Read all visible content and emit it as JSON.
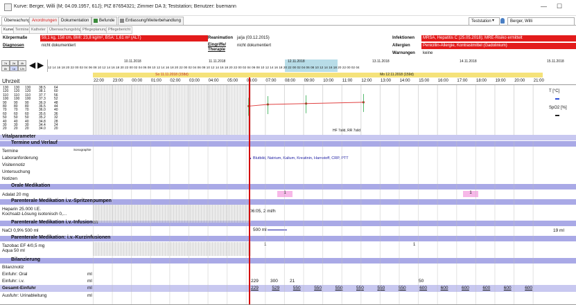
{
  "window": {
    "title": "Kurve: Berger, Willi (M; 04.09.1957, 61J); PIZ 87654321; Zimmer DA 3; Teststation; Benutzer: buemann",
    "station_select": "Teststation",
    "patient_select": "Berger, Willi"
  },
  "main_tabs": [
    "Überwachung",
    "Anordnungen",
    "Dokumentation",
    "Befunde",
    "Entlassung/Weiterbehandlung"
  ],
  "sub_tabs": [
    "Kurve",
    "Termine",
    "Katheter",
    "Überwachungsbögen",
    "Pflegeplanung",
    "Pflegebericht"
  ],
  "patient_info": {
    "koerpermasse_label": "Körpermaße",
    "koerpermasse_value": "59,1 kg, 158 cm, BMI: 23,8 kg/m², BSA: 1,61 m² (ALT)",
    "diagnosen_label": "Diagnosen",
    "diagnosen_value": "nicht dokumentiert",
    "reanimation_label": "Reanimation",
    "reanimation_value": "ja/ja (03.12.2015)",
    "eingriffe_label": "Eingriffe/ Therapie",
    "eingriffe_value": "nicht dokumentiert",
    "infektionen_label": "Infektionen",
    "infektionen_value": "MRSA, Hepatitis C (25.05.2018); MRE-Risiko ermittelt",
    "allergien_label": "Allergien",
    "allergien_value": "Penicillin-Allergie, Kontrastmittel (Gadolinium)",
    "warnungen_label": "Warnungen",
    "warnungen_value": "keine"
  },
  "timeline": {
    "zoom_buttons": [
      "7d",
      "2d",
      "4h",
      "8h",
      "1d",
      "12h"
    ],
    "dates": [
      "10.11.2018",
      "11.11.2018",
      "12.11.2018",
      "13.11.2018",
      "14.11.2018",
      "15.11.2018"
    ],
    "hour_ticks": "12 14 16 18 20 22 00 02 04 06 08 10 12 14 16 18 20 22 00 02 04 06 08 10 12 14 16 18 20 22 00 02 04 06 08 10 12 14 16 18 20 22 00 02 04 06 08 10 12 14 16 18 20 22 00 02 04 06 08 10 12 14 16 18 20 22 00 02 04",
    "day_left": "So 11.11.2018 (158d)",
    "day_right": "Mo 12.11.2018 (159d)",
    "uhrzeit_label": "Uhrzeit",
    "hours": [
      "22:00",
      "23:00",
      "00:00",
      "01:00",
      "02:00",
      "03:00",
      "04:00",
      "05:00",
      "06:00",
      "07:00",
      "08:00",
      "09:00",
      "10:00",
      "11:00",
      "12:00",
      "13:00",
      "14:00",
      "15:00",
      "16:00",
      "17:00",
      "18:00",
      "19:00",
      "20:00",
      "21:00"
    ]
  },
  "scale_columns": [
    [
      "130",
      "120",
      "110",
      "100",
      "90",
      "80",
      "70",
      "60",
      "50",
      "40",
      "30",
      "20"
    ],
    [
      "130",
      "120",
      "110",
      "100",
      "90",
      "80",
      "70",
      "60",
      "50",
      "40",
      "30",
      "20"
    ],
    [
      "130",
      "120",
      "110",
      "100",
      "90",
      "80",
      "70",
      "60",
      "50",
      "40",
      "30",
      "20"
    ],
    [
      "38.5",
      "38.1",
      "37.7",
      "37.3",
      "36.9",
      "36.5",
      "36.0",
      "35.6",
      "35.2",
      "34.8",
      "34.4",
      "34.0"
    ],
    [
      "64",
      "60",
      "56",
      "52",
      "48",
      "44",
      "40",
      "36",
      "32",
      "28",
      "24",
      "20"
    ]
  ],
  "legend_right": {
    "temp": "T [°C]",
    "spo2": "SpO2 [%]"
  },
  "vital_annotation": "HF 7sild, RR 7sild",
  "sections": {
    "vitalparameter": "Vitalparameter",
    "termine": "Termine und Verlauf",
    "orale": "Orale Medikation",
    "spritzen": "Parenterale Medikation i.v.-Spritzenpumpen",
    "infusionen": "Parenterale Medikation i.v.-Infusionen",
    "kurzinfusionen": "Parenterale Medikation: i.v.-Kurzinfusionen",
    "bilanzierung": "Bilanzierung"
  },
  "rows": {
    "termine": "Termine",
    "termine_badge": "Sonographie",
    "labor": "Laboranforderung",
    "labor_text": "Blutbild, Natrium, Kalium, Kreatinin, Harnstoff, CRP, PTT",
    "visiten": "Visitennotiz",
    "untersuchung": "Untersuchung",
    "notizen": "Notizen",
    "adalat": "Adalat 20 mg",
    "adalat_mark1": "1",
    "adalat_mark2": "1",
    "heparin1": "Heparin 25.000 I.E.",
    "heparin2": "Kochsalz-Lösung isotonisch 0,...",
    "heparin_rate": "06:05, 2 ml/h",
    "nacl": "NaCl 0,9% 500 ml",
    "nacl_val": "500 ml",
    "nacl_right": "19 ml",
    "tazobac1": "Tazobac EF 4/0,5 mg",
    "tazobac2": "Aqua 50 ml",
    "taz_mark1": "1",
    "taz_mark2": "1",
    "bilanznotiz": "Bilanznotiz",
    "oral": "Einfuhr: Oral",
    "iv": "Einfuhr: i.v.",
    "gesamt": "Gesamt-Einfuhr",
    "urin": "Ausfuhr: Urinableitung",
    "unit_ml": "ml"
  },
  "einfuhr_iv_values": [
    "229",
    "300",
    "21",
    "50"
  ],
  "gesamt_values": [
    "229",
    "529",
    "550",
    "550",
    "550",
    "550",
    "550",
    "550",
    "600",
    "600",
    "600",
    "600",
    "600",
    "600"
  ],
  "chart_data": {
    "type": "line",
    "series": [
      {
        "x": [
          "06:00",
          "07:00",
          "09:00",
          "12:00"
        ],
        "values": [
          84,
          88,
          90,
          93
        ]
      }
    ]
  },
  "colors": {
    "accent": "#c8c8f0",
    "alarm": "#e31b1b",
    "nowline": "#d40000",
    "dayband": "#f5e27a"
  }
}
